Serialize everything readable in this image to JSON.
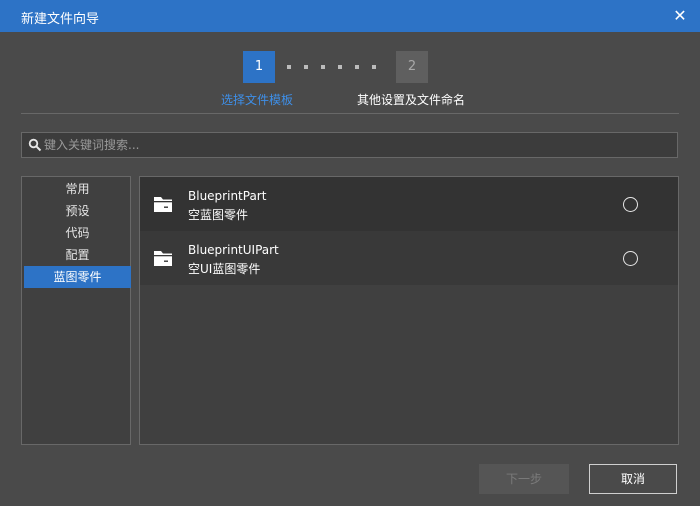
{
  "window": {
    "title": "新建文件向导",
    "close_icon": "close-icon"
  },
  "steps": [
    {
      "number": "1",
      "label": "选择文件模板",
      "state": "active"
    },
    {
      "number": "2",
      "label": "其他设置及文件命名",
      "state": "inactive"
    }
  ],
  "search": {
    "placeholder": "键入关键词搜索...",
    "value": "",
    "icon": "search-icon"
  },
  "sidebar": {
    "items": [
      {
        "label": "常用"
      },
      {
        "label": "预设"
      },
      {
        "label": "代码"
      },
      {
        "label": "配置"
      },
      {
        "label": "蓝图零件",
        "selected": true
      }
    ]
  },
  "templates": [
    {
      "name": "BlueprintPart",
      "description": "空蓝图零件",
      "icon": "folder-icon",
      "selected": false
    },
    {
      "name": "BlueprintUIPart",
      "description": "空UI蓝图零件",
      "icon": "folder-icon",
      "selected": false
    }
  ],
  "footer": {
    "next_label": "下一步",
    "cancel_label": "取消"
  },
  "colors": {
    "accent": "#2d73c6",
    "background": "#4a4a4a",
    "active_step_label": "#3e8fe8"
  }
}
